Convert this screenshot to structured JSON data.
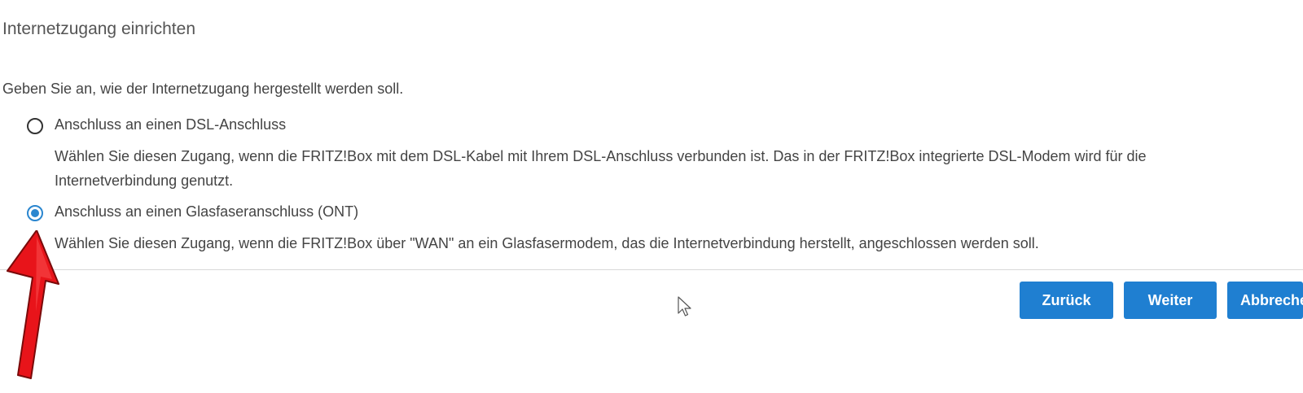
{
  "page": {
    "title": "Internetzugang einrichten",
    "intro": "Geben Sie an, wie der Internetzugang hergestellt werden soll."
  },
  "options": [
    {
      "label": "Anschluss an einen DSL-Anschluss",
      "description": "Wählen Sie diesen Zugang, wenn die FRITZ!Box mit dem DSL-Kabel mit Ihrem DSL-Anschluss verbunden ist. Das in der FRITZ!Box integrierte DSL-Modem wird für die Internetverbindung genutzt.",
      "selected": false
    },
    {
      "label": "Anschluss an einen Glasfaseranschluss (ONT)",
      "description": "Wählen Sie diesen Zugang, wenn die FRITZ!Box über \"WAN\" an ein Glasfasermodem, das die Internetverbindung herstellt, angeschlossen werden soll.",
      "selected": true
    }
  ],
  "buttons": {
    "back": "Zurück",
    "next": "Weiter",
    "cancel": "Abbrechen"
  },
  "colors": {
    "accent": "#1f7fd1",
    "radio_checked": "#2a86cf",
    "annotation_arrow": "#e8141a"
  },
  "icons": {
    "annotation": "red-arrow-icon",
    "pointer": "mouse-cursor-icon"
  }
}
